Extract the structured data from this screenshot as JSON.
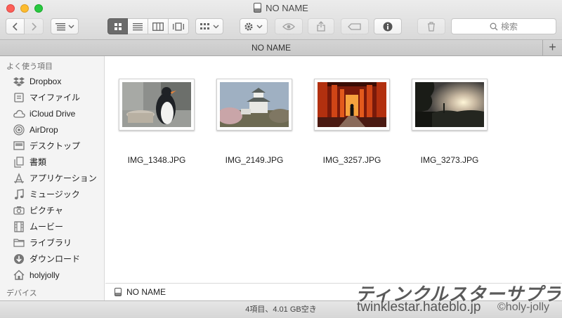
{
  "window": {
    "title": "NO NAME",
    "tab_label": "NO NAME",
    "tab_add_symbol": "+"
  },
  "toolbar": {
    "search_placeholder": "検索",
    "icons": [
      "back-icon",
      "forward-icon",
      "arrange-icon",
      "icon-view-icon",
      "list-view-icon",
      "column-view-icon",
      "coverflow-view-icon",
      "group-icon",
      "gear-icon",
      "quicklook-eye-icon",
      "share-icon",
      "tag-icon",
      "info-icon",
      "trash-icon",
      "search-icon"
    ]
  },
  "sidebar": {
    "favorites_header": "よく使う項目",
    "items": [
      {
        "label": "Dropbox",
        "icon": "dropbox-icon"
      },
      {
        "label": "マイファイル",
        "icon": "all-files-icon"
      },
      {
        "label": "iCloud Drive",
        "icon": "cloud-icon"
      },
      {
        "label": "AirDrop",
        "icon": "airdrop-icon"
      },
      {
        "label": "デスクトップ",
        "icon": "desktop-icon"
      },
      {
        "label": "書類",
        "icon": "documents-icon"
      },
      {
        "label": "アプリケーション",
        "icon": "applications-icon"
      },
      {
        "label": "ミュージック",
        "icon": "music-icon"
      },
      {
        "label": "ピクチャ",
        "icon": "camera-icon"
      },
      {
        "label": "ムービー",
        "icon": "film-icon"
      },
      {
        "label": "ライブラリ",
        "icon": "folder-icon"
      },
      {
        "label": "ダウンロード",
        "icon": "download-icon"
      },
      {
        "label": "holyjolly",
        "icon": "home-icon"
      }
    ],
    "devices_header": "デバイス"
  },
  "files": [
    {
      "name": "IMG_1348.JPG"
    },
    {
      "name": "IMG_2149.JPG"
    },
    {
      "name": "IMG_3257.JPG"
    },
    {
      "name": "IMG_3273.JPG"
    }
  ],
  "pathbar": {
    "label": "NO NAME"
  },
  "status": {
    "text": "4項目、4.01 GB空き"
  },
  "watermark": {
    "logo": "ティンクルスターサプライズ",
    "url": "twinklestar.hateblo.jp",
    "credit": "©holy-jolly"
  },
  "colors": {
    "close": "#fc5f57",
    "minimize": "#fdbc2e",
    "maximize": "#29c841",
    "active_segment": "#6b6b6b"
  }
}
